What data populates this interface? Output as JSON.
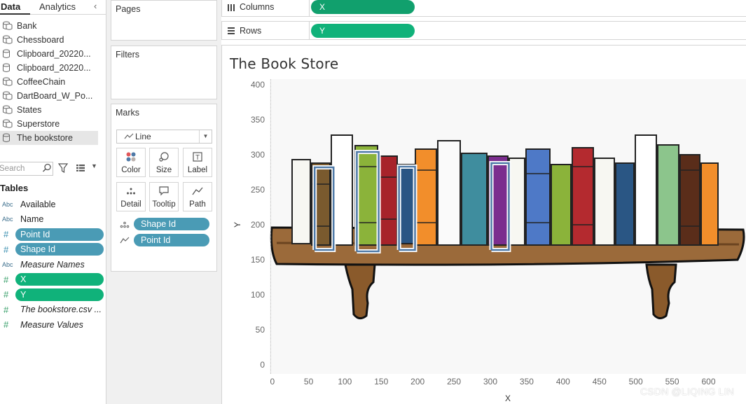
{
  "left_pane": {
    "tab_data": "Data",
    "tab_analytics": "Analytics",
    "data_sources": [
      {
        "name": "Bank",
        "icon": "database-icon"
      },
      {
        "name": "Chessboard",
        "icon": "database-icon"
      },
      {
        "name": "Clipboard_20220...",
        "icon": "cylinder-icon"
      },
      {
        "name": "Clipboard_20220...",
        "icon": "cylinder-icon"
      },
      {
        "name": "CoffeeChain",
        "icon": "database-icon"
      },
      {
        "name": "DartBoard_W_Po...",
        "icon": "database-icon"
      },
      {
        "name": "States",
        "icon": "database-icon"
      },
      {
        "name": "Superstore",
        "icon": "database-icon"
      },
      {
        "name": "The bookstore",
        "icon": "cylinder-icon",
        "selected": true
      }
    ],
    "search_placeholder": "Search",
    "tables_heading": "Tables",
    "fields": [
      {
        "type": "Abc",
        "name": "Available"
      },
      {
        "type": "Abc",
        "name": "Name"
      },
      {
        "type": "#",
        "name": "Point Id",
        "pill": "blue"
      },
      {
        "type": "#",
        "name": "Shape Id",
        "pill": "blue"
      },
      {
        "type": "Abc",
        "name": "Measure Names",
        "italic": true
      },
      {
        "type": "#",
        "name": "X",
        "pill": "green"
      },
      {
        "type": "#",
        "name": "Y",
        "pill": "green"
      },
      {
        "type": "#",
        "name": "The bookstore.csv ...",
        "italic": true
      },
      {
        "type": "#",
        "name": "Measure Values",
        "italic": true
      }
    ]
  },
  "cards": {
    "pages": "Pages",
    "filters": "Filters",
    "marks": "Marks",
    "mark_type": "Line",
    "buttons": {
      "color": "Color",
      "size": "Size",
      "label": "Label",
      "detail": "Detail",
      "tooltip": "Tooltip",
      "path": "Path"
    },
    "mark_fields": [
      {
        "name": "Shape Id",
        "icon": "detail-dots-icon"
      },
      {
        "name": "Point Id",
        "icon": "path-icon"
      }
    ]
  },
  "shelves": {
    "columns_label": "Columns",
    "columns_pill": "X",
    "rows_label": "Rows",
    "rows_pill": "Y"
  },
  "viz": {
    "title": "The Book Store",
    "watermark": "CSDN @LIQING LIN"
  },
  "chart_data": {
    "type": "line",
    "title": "The Book Store",
    "xlabel": "X",
    "ylabel": "Y",
    "xlim": [
      0,
      645
    ],
    "ylim": [
      0,
      420
    ],
    "x_ticks": [
      "0",
      "50",
      "100",
      "150",
      "200",
      "250",
      "300",
      "350",
      "400",
      "450",
      "500",
      "550",
      "600"
    ],
    "y_ticks": [
      "0",
      "50",
      "100",
      "150",
      "200",
      "250",
      "300",
      "350",
      "400"
    ],
    "series": [
      {
        "shape": 1,
        "x": [
          58,
          58,
          84,
          84,
          58
        ],
        "y": [
          165,
          283,
          283,
          165,
          165
        ]
      },
      {
        "shape": 2,
        "x": [
          116,
          116,
          146,
          146,
          116
        ],
        "y": [
          163,
          305,
          305,
          163,
          163
        ]
      },
      {
        "shape": 3,
        "x": [
          174,
          174,
          196,
          196,
          174
        ],
        "y": [
          165,
          284,
          284,
          165,
          165
        ]
      },
      {
        "shape": 4,
        "x": [
          301,
          301,
          325,
          325,
          301
        ],
        "y": [
          165,
          289,
          289,
          165,
          165
        ]
      }
    ],
    "grid": false,
    "legend": "none",
    "colors": {
      "outline": "#4e79a7",
      "accent_green": "#10b27a",
      "accent_blue": "#4a9bb5"
    }
  }
}
